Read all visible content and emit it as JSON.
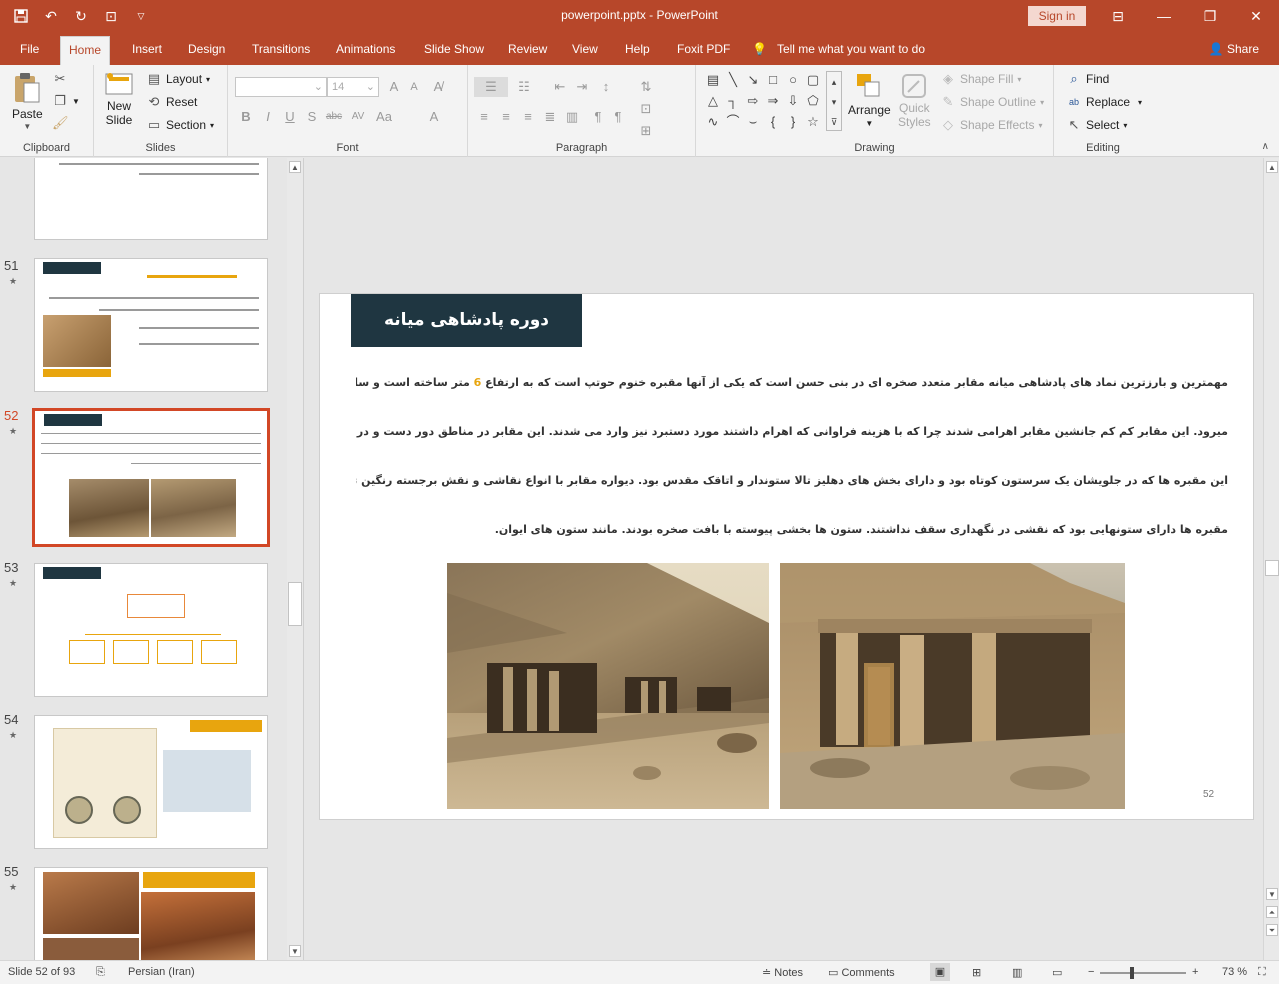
{
  "app": {
    "doc_title": "powerpoint.pptx - PowerPoint",
    "sign_in": "Sign in",
    "share": "Share",
    "tell_me": "Tell me what you want to do"
  },
  "colors": {
    "accent": "#b7472a",
    "banner": "#1f3641",
    "highlight": "#e8a50e"
  },
  "tabs": [
    "File",
    "Home",
    "Insert",
    "Design",
    "Transitions",
    "Animations",
    "Slide Show",
    "Review",
    "View",
    "Help",
    "Foxit PDF"
  ],
  "ribbon": {
    "clipboard": {
      "label": "Clipboard",
      "paste": "Paste"
    },
    "slides": {
      "label": "Slides",
      "new_slide_1": "New",
      "new_slide_2": "Slide",
      "layout": "Layout",
      "reset": "Reset",
      "section": "Section"
    },
    "font": {
      "label": "Font",
      "size": "14"
    },
    "paragraph": {
      "label": "Paragraph"
    },
    "drawing": {
      "label": "Drawing",
      "arrange": "Arrange",
      "quick_styles_1": "Quick",
      "quick_styles_2": "Styles",
      "shape_fill": "Shape Fill",
      "shape_outline": "Shape Outline",
      "shape_effects": "Shape Effects"
    },
    "editing": {
      "label": "Editing",
      "find": "Find",
      "replace": "Replace",
      "select": "Select"
    }
  },
  "thumbnails": [
    {
      "number": "51"
    },
    {
      "number": "52"
    },
    {
      "number": "53"
    },
    {
      "number": "54"
    },
    {
      "number": "55"
    }
  ],
  "slide": {
    "title": "دوره پادشاهی میانه",
    "line1_before": "مهمترین و بارزترین نماد های پادشاهی میانه مقابر متعدد صخره ای در بنی حسن است که یکی از آنها مقبره خنوم حوتپ است که به ارتفاع ",
    "line1_number": "6",
    "line1_after": " متر ساخته است و سالم ترین آنها به شمار",
    "line2": "میرود. این مقابر کم کم جانشین مقابر اهرامی شدند چرا که با هزینه فراوانی که اهرام داشتند مورد دستبرد نیز وارد می شدند. این مقابر در مناطق دور دست و در صخره ها کنده می شده",
    "line3": "این مقبره ها که در جلویشان یک سرستون کوتاه بود و دارای بخش های دهلیز تالا ستوندار و اتاقک مقدس بود. دیواره مقابر با انواع نقاشی و نقش برجسته رنگین تزیین میگردید. داخل",
    "line4": "مقبره ها دارای ستونهایی بود که نقشی در نگهداری سقف نداشتند. ستون ها بخشی پیوسته با بافت صخره بودند. مانند ستون های ایوان.",
    "number": "52"
  },
  "status": {
    "slide_info": "Slide 52 of 93",
    "language": "Persian (Iran)",
    "notes": "Notes",
    "comments": "Comments",
    "zoom": "73 %"
  }
}
